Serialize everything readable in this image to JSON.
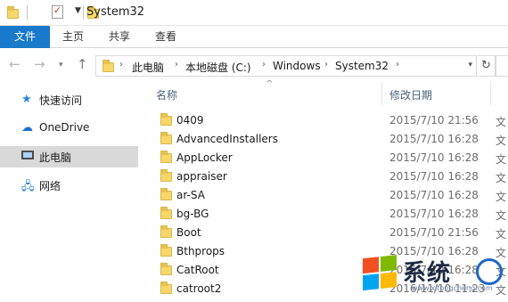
{
  "window": {
    "title": "System32"
  },
  "ribbon": {
    "tabs": [
      {
        "label": "文件"
      },
      {
        "label": "主页"
      },
      {
        "label": "共享"
      },
      {
        "label": "查看"
      }
    ]
  },
  "address": {
    "crumbs": [
      "此电脑",
      "本地磁盘 (C:)",
      "Windows",
      "System32"
    ]
  },
  "navpane": {
    "items": [
      {
        "label": "快速访问",
        "icon": "star-icon"
      },
      {
        "label": "OneDrive",
        "icon": "cloud-icon"
      },
      {
        "label": "此电脑",
        "icon": "pc-icon",
        "selected": true
      },
      {
        "label": "网络",
        "icon": "network-icon"
      }
    ]
  },
  "columns": {
    "name": "名称",
    "date": "修改日期"
  },
  "files": [
    {
      "name": "0409",
      "date": "2015/7/10 21:56",
      "type": "文"
    },
    {
      "name": "AdvancedInstallers",
      "date": "2015/7/10 16:28",
      "type": "文"
    },
    {
      "name": "AppLocker",
      "date": "2015/7/10 16:28",
      "type": "文"
    },
    {
      "name": "appraiser",
      "date": "2015/7/10 16:28",
      "type": "文"
    },
    {
      "name": "ar-SA",
      "date": "2015/7/10 16:28",
      "type": "文"
    },
    {
      "name": "bg-BG",
      "date": "2015/7/10 16:28",
      "type": "文"
    },
    {
      "name": "Boot",
      "date": "2015/7/10 21:56",
      "type": "文"
    },
    {
      "name": "Bthprops",
      "date": "2015/7/10 16:28",
      "type": "文"
    },
    {
      "name": "CatRoot",
      "date": "2015/7/10 16:28",
      "type": "文"
    },
    {
      "name": "catroot2",
      "date": "2016/11/10 11:23",
      "type": "文"
    }
  ],
  "watermark": {
    "text": "系统",
    "url": "www.xitongcheng.com"
  },
  "colors": {
    "accent": "#1979ca",
    "selection": "#d9d9d9",
    "folder": "#f7d76a"
  }
}
